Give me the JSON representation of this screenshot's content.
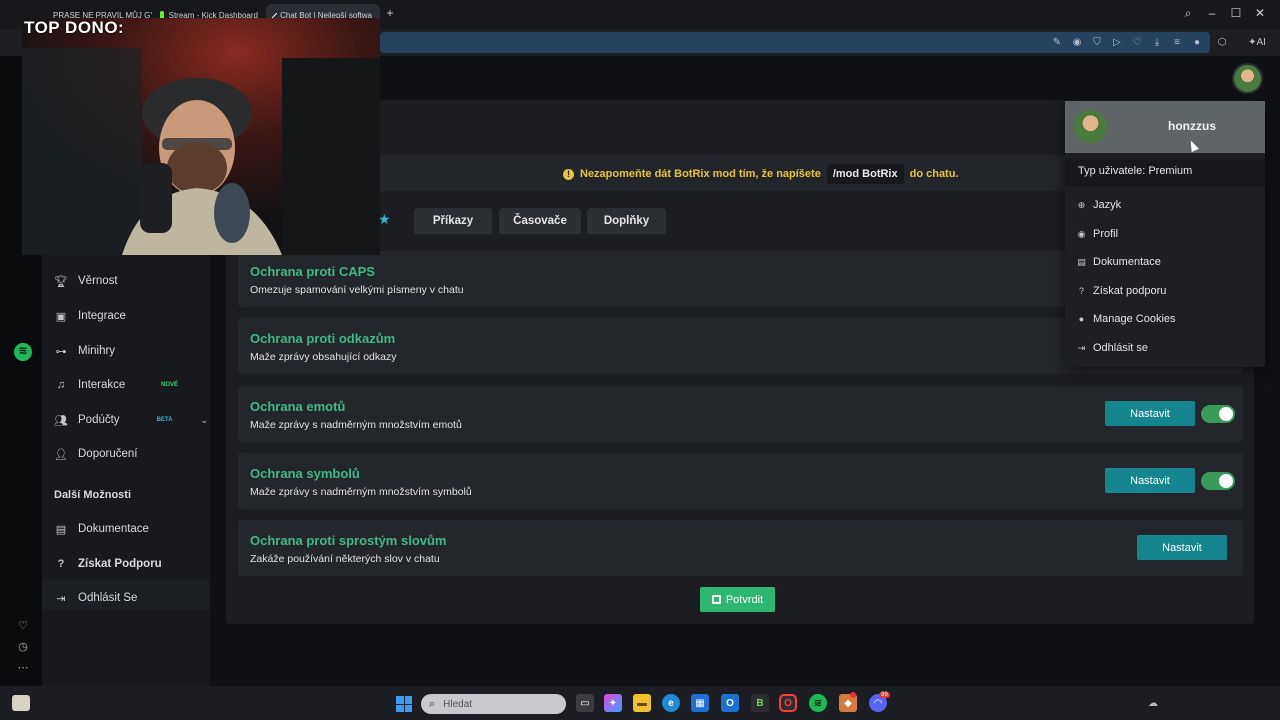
{
  "overlay": {
    "label": "TOP DONO:"
  },
  "browser": {
    "tabs": [
      {
        "label": "PRASE NE PRAVIL MŮJ GY",
        "active": false,
        "color": "#e6403a"
      },
      {
        "label": "Stream - Kick Dashboard",
        "active": false,
        "color": "#53fc18"
      },
      {
        "label": "Chat Bot | Nejlepší softwa",
        "active": true,
        "color": "#ffffff"
      }
    ],
    "ai_label": "AI"
  },
  "sidebar": {
    "items": [
      {
        "label": "Věrnost",
        "icon": "trophy-icon"
      },
      {
        "label": "Integrace",
        "icon": "integration-icon"
      },
      {
        "label": "Minihry",
        "icon": "gamepad-icon"
      },
      {
        "label": "Interakce",
        "icon": "music-icon",
        "badge": "NOVÉ",
        "badge_color": "#3fd16b"
      },
      {
        "label": "Podúčty",
        "icon": "users-icon",
        "badge": "BETA",
        "badge_color": "#2fb9c9"
      },
      {
        "label": "Doporučení",
        "icon": "people-icon"
      }
    ],
    "section_title": "Další Možnosti",
    "more": [
      {
        "label": "Dokumentace",
        "icon": "book-icon"
      },
      {
        "label": "Získat Podporu",
        "icon": "help-icon"
      },
      {
        "label": "Odhlásit Se",
        "icon": "logout-icon"
      }
    ]
  },
  "notice": {
    "text": "Nezapomeňte dát BotRix mod tím, že napíšete",
    "command": "/mod BotRix",
    "after": "do chatu."
  },
  "tabs": [
    {
      "label": "Příkazy"
    },
    {
      "label": "Časovače"
    },
    {
      "label": "Doplňky"
    }
  ],
  "cards": [
    {
      "title": "Ochrana proti CAPS",
      "desc": "Omezuje spamování velkými písmeny v chatu"
    },
    {
      "title": "Ochrana proti odkazům",
      "desc": "Maže zprávy obsahující odkazy"
    },
    {
      "title": "Ochrana emotů",
      "desc": "Maže zprávy s nadměrným množstvím emotů",
      "button": "Nastavit",
      "enabled": true
    },
    {
      "title": "Ochrana symbolů",
      "desc": "Maže zprávy s nadměrným množstvím symbolů",
      "button": "Nastavit",
      "enabled": true
    },
    {
      "title": "Ochrana proti sprostým slovům",
      "desc": "Zakáže používání některých slov v chatu",
      "button": "Nastavit"
    }
  ],
  "confirm_label": "Potvrdit",
  "user_menu": {
    "username": "honzzus",
    "user_type": "Typ uživatele: Premium",
    "items": [
      {
        "label": "Jazyk",
        "icon": "globe-icon"
      },
      {
        "label": "Profil",
        "icon": "profile-icon"
      },
      {
        "label": "Dokumentace",
        "icon": "book-icon"
      },
      {
        "label": "Získat podporu",
        "icon": "help-icon"
      },
      {
        "label": "Manage Cookies",
        "icon": "cookie-icon"
      },
      {
        "label": "Odhlásit se",
        "icon": "logout-icon"
      }
    ]
  },
  "taskbar": {
    "search_placeholder": "Hledat",
    "discord_badge": "99"
  },
  "colors": {
    "accent_green": "#3fb984",
    "button_teal": "#17858f",
    "confirm_green": "#2eb673",
    "notice_yellow": "#e8c33d"
  }
}
